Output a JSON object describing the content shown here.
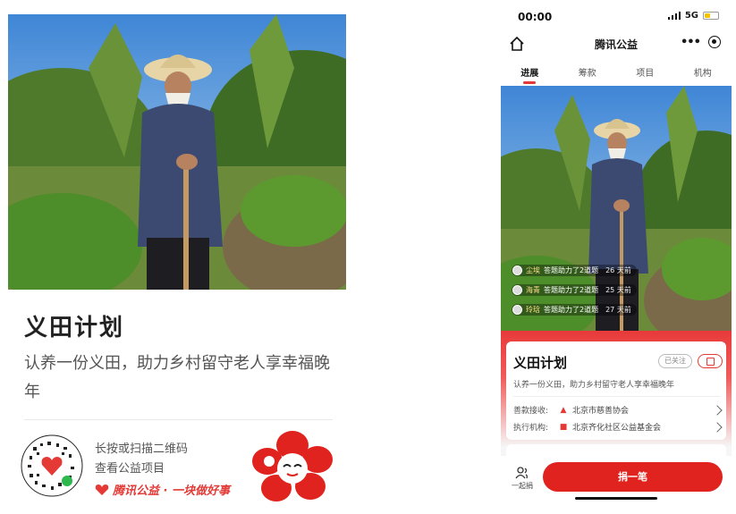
{
  "poster": {
    "title": "义田计划",
    "subtitle": "认养一份义田，助力乡村留守老人享幸福晚年",
    "qr_line1": "长按或扫描二维码",
    "qr_line2": "查看公益项目",
    "brand": "腾讯公益 · 一块做好事"
  },
  "status": {
    "time": "00:00",
    "network": "5G"
  },
  "nav": {
    "title": "腾讯公益",
    "more": "•••"
  },
  "tabs": [
    {
      "label": "进展"
    },
    {
      "label": "筹款"
    },
    {
      "label": "项目"
    },
    {
      "label": "机构"
    }
  ],
  "feed": [
    {
      "name": "尘埃",
      "action": "答题助力了2道题",
      "time": "26 天前"
    },
    {
      "name": "海青",
      "action": "答题助力了2道题",
      "time": "25 天前"
    },
    {
      "name": "玲琀",
      "action": "答题助力了2道题",
      "time": "27 天前"
    }
  ],
  "project": {
    "title": "义田计划",
    "follow": "已关注",
    "subtitle": "认养一份义田，助力乡村留守老人享幸福晚年",
    "receiver_label": "善款接收:",
    "receiver": "北京市慈善协会",
    "executor_label": "执行机构:",
    "executor": "北京齐化社区公益基金会"
  },
  "bottom": {
    "together": "一起捐",
    "donate": "捐一笔"
  },
  "colors": {
    "brand_red": "#e0231f",
    "accent_red": "#e53935"
  }
}
